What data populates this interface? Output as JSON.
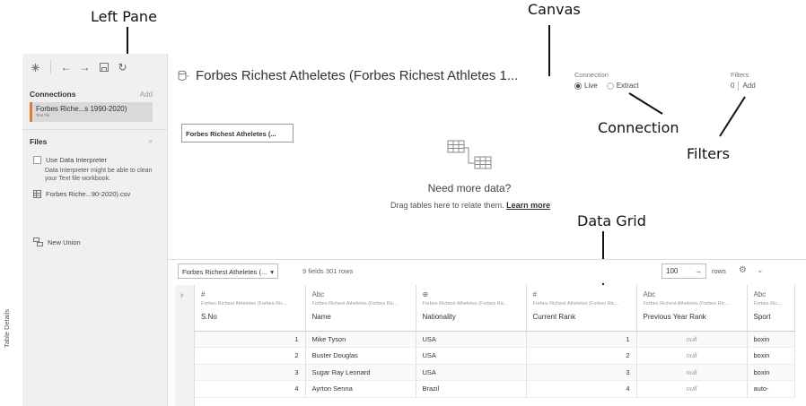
{
  "annotations": {
    "left_pane": "Left Pane",
    "canvas": "Canvas",
    "connection": "Connection",
    "filters": "Filters",
    "data_grid": "Data Grid"
  },
  "left_pane": {
    "connections_header": "Connections",
    "connections_add": "Add",
    "connection_item": "Forbes Riche...s 1990-2020)",
    "connection_sub": "Text file",
    "files_header": "Files",
    "use_interpreter": "Use Data Interpreter",
    "interpreter_desc": "Data Interpreter might be able to clean your Text file workbook.",
    "file_item": "Forbes Riche...90-2020).csv",
    "new_union": "New Union"
  },
  "canvas": {
    "title": "Forbes Richest Atheletes (Forbes Richest Athletes 1...",
    "connection_label": "Connection",
    "live": "Live",
    "extract": "Extract",
    "filters_label": "Filters",
    "filters_count": "0",
    "filters_add": "Add",
    "table_chip": "Forbes Richest Atheletes (...",
    "need_more": "Need more data?",
    "drag_tables": "Drag tables here to relate them.",
    "learn_more": "Learn more"
  },
  "grid_toolbar": {
    "table_select": "Forbes Richest Atheletes (...",
    "fields_rows": "9 fields 301 rows",
    "rows_value": "100",
    "rows_label": "rows"
  },
  "grid": {
    "side_label": "Table Details",
    "columns": [
      {
        "type": "#",
        "source": "Forbes Richest Atheletes (Forbes Ric...",
        "name": "S.No"
      },
      {
        "type": "Abc",
        "source": "Forbes Richest Atheletes (Forbes Ric...",
        "name": "Name"
      },
      {
        "type": "⊕",
        "source": "Forbes Richest Atheletes (Forbes Ric...",
        "name": "Nationality"
      },
      {
        "type": "#",
        "source": "Forbes Richest Atheletes (Forbes Ric...",
        "name": "Current Rank"
      },
      {
        "type": "Abc",
        "source": "Forbes Richest Atheletes (Forbes Ric...",
        "name": "Previous Year Rank"
      },
      {
        "type": "Abc",
        "source": "Forbes Ric...",
        "name": "Sport"
      }
    ],
    "rows": [
      [
        "1",
        "Mike Tyson",
        "USA",
        "1",
        "null",
        "boxin"
      ],
      [
        "2",
        "Buster Douglas",
        "USA",
        "2",
        "null",
        "boxin"
      ],
      [
        "3",
        "Sugar Ray Leonard",
        "USA",
        "3",
        "null",
        "boxin"
      ],
      [
        "4",
        "Ayrton Senna",
        "Brazil",
        "4",
        "null",
        "auto-"
      ]
    ]
  }
}
